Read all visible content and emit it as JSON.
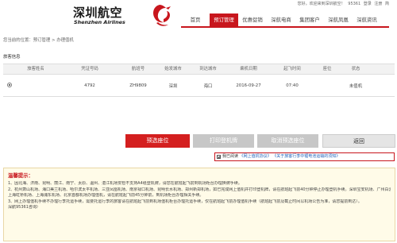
{
  "toplinks": {
    "welcome": "您好，欢迎来到深圳航空！",
    "hotline": "95361",
    "login": "登录",
    "register": "注册",
    "language": "简"
  },
  "logo": {
    "cn": "深圳航空",
    "en": "Shenzhen Airlines"
  },
  "nav": {
    "items": [
      {
        "label": "首页",
        "active": false
      },
      {
        "label": "预订管理",
        "active": true
      },
      {
        "label": "优惠促销",
        "active": false
      },
      {
        "label": "深航电商",
        "active": false
      },
      {
        "label": "集团客户",
        "active": false
      },
      {
        "label": "深航凤凰",
        "active": false
      },
      {
        "label": "深航资讯",
        "active": false
      }
    ]
  },
  "breadcrumb": "您当前的位置：预订管理 > 办理值机",
  "section_label": "旅客信息",
  "table": {
    "headers": [
      "",
      "旅客姓名",
      "凭证号码",
      "航班号",
      "始发城市",
      "到达城市",
      "乘机日期",
      "起飞时间",
      "座位",
      "状态"
    ],
    "rows": [
      {
        "cert": "4792",
        "flight": "ZH9809",
        "from": "深圳",
        "to": "海口",
        "date": "2016-09-27",
        "time": "07:40",
        "seat": "",
        "status": "未值机"
      }
    ]
  },
  "buttons": {
    "select_seat": "预选座位",
    "print_pass": "打印登机牌",
    "cancel_seat": "取消预选座位",
    "back": "返回"
  },
  "agreement": {
    "prefix": "我已阅读",
    "link1": "《网上值机协议》",
    "link2": "《关于旅客行李中锂电池运输的须知》"
  },
  "tips": {
    "title": "温馨提示：",
    "lines": [
      "1、因北海、济南、昆明、丽江、南宁、太原、温州、湛江机场安检不支持A4纸登机牌，请您在航班起飞前到机场柜台办理换牌手续。",
      "2、杭州萧山机场、海口美兰机场、哈尔滨太平机场、三亚凤凰机场、南京禄口机场、昆明长水机场、郑州新郑机场，如已完成网上值机并打印登机牌，请在航班起飞前40分钟停止办理登机手续。深圳宝安机场、广州白云机场，",
      "  上海虹桥机场、上海浦东机场、北京首都机场办理值机，请在航班起飞前45分钟前，到机场柜台办理相关手续。",
      "3、网上办理值机手续不办理行李托运手续，需要托运行李的旅客请在航班起飞前到机场值机柜台办理托运手续，仅在航班起飞前办理值机手续（航班起飞前及截止时间以机场公告为准，请您提前到达）。",
      "  深航95361咨询）"
    ]
  },
  "colors": {
    "brand_red": "#c8161d",
    "button_red": "#d41f1f",
    "button_gray": "#c7c7c7",
    "link_blue": "#1d5fb8"
  }
}
